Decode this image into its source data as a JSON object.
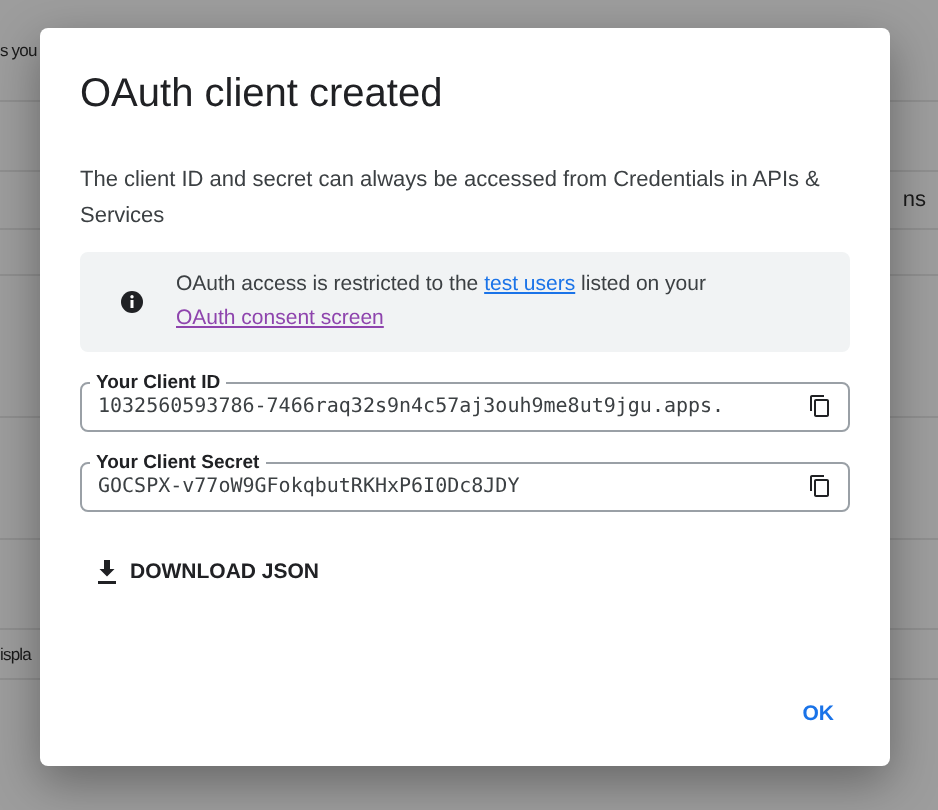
{
  "background": {
    "top_text": "s you",
    "right_text": "ns",
    "bottom_text": "ispla"
  },
  "dialog": {
    "title": "OAuth client created",
    "description": "The client ID and secret can always be accessed from Credentials in APIs & Services",
    "notice": {
      "parts": [
        {
          "kind": "text",
          "text": "OAuth access is restricted to the "
        },
        {
          "kind": "link",
          "text": "test users",
          "visited": false
        },
        {
          "kind": "text",
          "text": " listed on your "
        },
        {
          "kind": "link",
          "text": "OAuth consent screen",
          "visited": true
        }
      ]
    },
    "fields": [
      {
        "label": "Your Client ID",
        "value": "1032560593786-7466raq32s9n4c57aj3ouh9me8ut9jgu.apps."
      },
      {
        "label": "Your Client Secret",
        "value": "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"
      }
    ],
    "download": "DOWNLOAD JSON",
    "ok": "OK"
  }
}
